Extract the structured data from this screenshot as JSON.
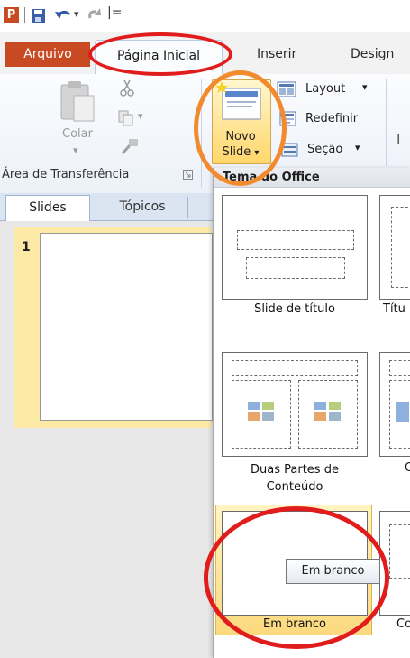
{
  "quick_access": {
    "icons": [
      "powerpoint-app-icon",
      "save-icon",
      "undo-icon",
      "redo-icon",
      "customize-toolbar-icon"
    ],
    "undo_arrow": "▾",
    "customize_glyph": "|="
  },
  "tabs": {
    "file": "Arquivo",
    "home": "Página Inicial",
    "insert": "Inserir",
    "design": "Design"
  },
  "ribbon": {
    "paste_label": "Colar",
    "clipboard_group_label": "Área de Transferência",
    "new_slide_line1": "Novo",
    "new_slide_line2": "Slide",
    "dropdown_arrow": "▾",
    "layout_label": "Layout",
    "reset_label": "Redefinir",
    "section_label": "Seção"
  },
  "slides_pane": {
    "tab_slides": "Slides",
    "tab_outline": "Tópicos",
    "slide_number": "1"
  },
  "layout_gallery": {
    "header": "Tema do Office",
    "items": [
      {
        "label": "Slide de título"
      },
      {
        "label": "Títu"
      },
      {
        "label_line1": "Duas Partes de",
        "label_line2": "Conteúdo"
      },
      {
        "label": "C"
      },
      {
        "label": "Em branco"
      },
      {
        "label": "Co"
      }
    ]
  },
  "tooltip": {
    "text": "Em branco"
  },
  "colors": {
    "file_tab": "#c84a23",
    "highlight_red": "#e01c1c",
    "highlight_orange": "#f28a2e",
    "selected_gold": "#fbd97e"
  }
}
